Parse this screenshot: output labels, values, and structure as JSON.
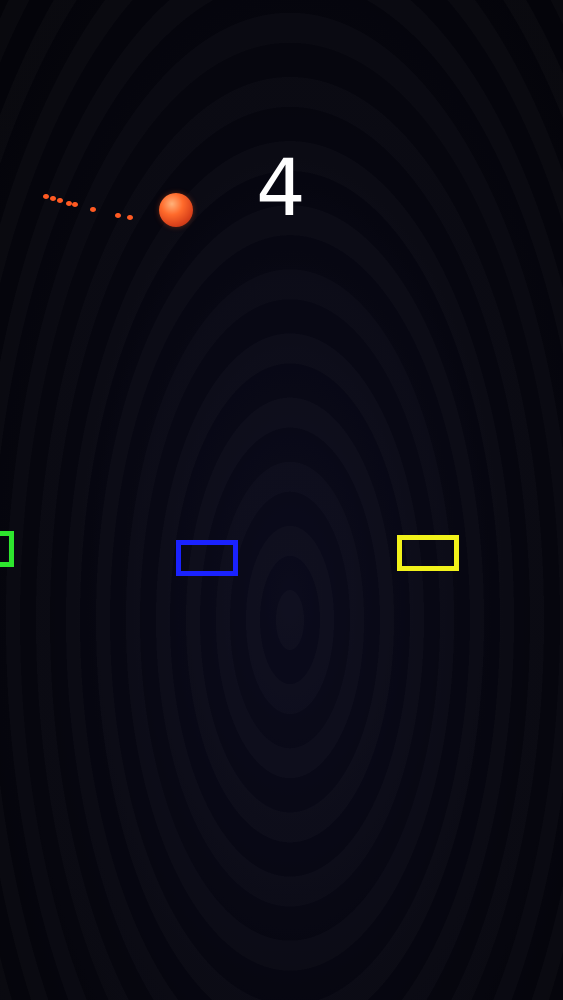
{
  "score": {
    "value": "4"
  },
  "ball": {
    "color": "#ff6a2b",
    "trail_color": "#ff5a22",
    "trail_length": 8
  },
  "platforms": [
    {
      "color": "#2ee62e"
    },
    {
      "color": "#1a22ff"
    },
    {
      "color": "#f2f21a"
    }
  ],
  "background": {
    "color": "#05050f"
  }
}
